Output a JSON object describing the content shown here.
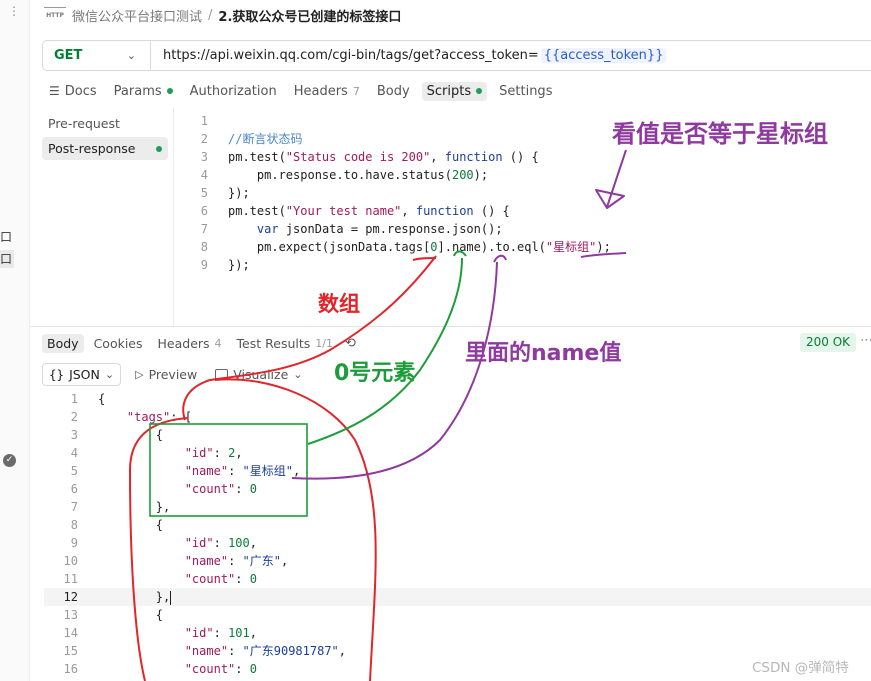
{
  "breadcrumb": {
    "icon": "http-icon",
    "parent": "微信公众平台接口测试",
    "separator": "/",
    "current": "2.获取公众号已创建的标签接口"
  },
  "request": {
    "method": "GET",
    "url_prefix": "https://api.weixin.qq.com/cgi-bin/tags/get?access_token=",
    "url_variable": "{{access_token}}"
  },
  "request_tabs": [
    {
      "label": "Docs",
      "count": "",
      "dot": false,
      "active": false
    },
    {
      "label": "Params",
      "count": "",
      "dot": true,
      "active": false
    },
    {
      "label": "Authorization",
      "count": "",
      "dot": false,
      "active": false
    },
    {
      "label": "Headers",
      "count": "7",
      "dot": false,
      "active": false
    },
    {
      "label": "Body",
      "count": "",
      "dot": false,
      "active": false
    },
    {
      "label": "Scripts",
      "count": "",
      "dot": true,
      "active": true
    },
    {
      "label": "Settings",
      "count": "",
      "dot": false,
      "active": false
    }
  ],
  "scripts_sidebar": [
    {
      "label": "Pre-request",
      "dot": false,
      "active": false
    },
    {
      "label": "Post-response",
      "dot": true,
      "active": true
    }
  ],
  "script_lines": [
    "",
    "//断言状态码",
    "pm.test(\"Status code is 200\", function () {",
    "    pm.response.to.have.status(200);",
    "});",
    "pm.test(\"Your test name\", function () {",
    "    var jsonData = pm.response.json();",
    "    pm.expect(jsonData.tags[0].name).to.eql(\"星标组\");",
    "});"
  ],
  "response_tabs": [
    {
      "label": "Body",
      "count": "",
      "active": true
    },
    {
      "label": "Cookies",
      "count": "",
      "active": false
    },
    {
      "label": "Headers",
      "count": "4",
      "active": false
    },
    {
      "label": "Test Results",
      "count": "1/1",
      "active": false
    }
  ],
  "status": "200 OK",
  "response_toolbar": {
    "format": "JSON",
    "preview": "Preview",
    "visualize": "Visualize"
  },
  "json_lines": [
    "{",
    "    \"tags\": [",
    "        {",
    "            \"id\": 2,",
    "            \"name\": \"星标组\",",
    "            \"count\": 0",
    "        },",
    "        {",
    "            \"id\": 100,",
    "            \"name\": \"广东\",",
    "            \"count\": 0",
    "        },",
    "        {",
    "            \"id\": 101,",
    "            \"name\": \"广东90981787\",",
    "            \"count\": 0"
  ],
  "annotations": {
    "top": "看值是否等于星标组",
    "array": "数组",
    "zero": "0号元素",
    "name": "里面的name值"
  },
  "left_rail": {
    "frag1": "口",
    "frag2": "口"
  },
  "watermark": "CSDN @弹简特",
  "colors": {
    "get_method": "#007f31",
    "annotation_purple": "#8e3a9e",
    "annotation_red": "#e0262b",
    "annotation_green": "#1d9c3a"
  }
}
